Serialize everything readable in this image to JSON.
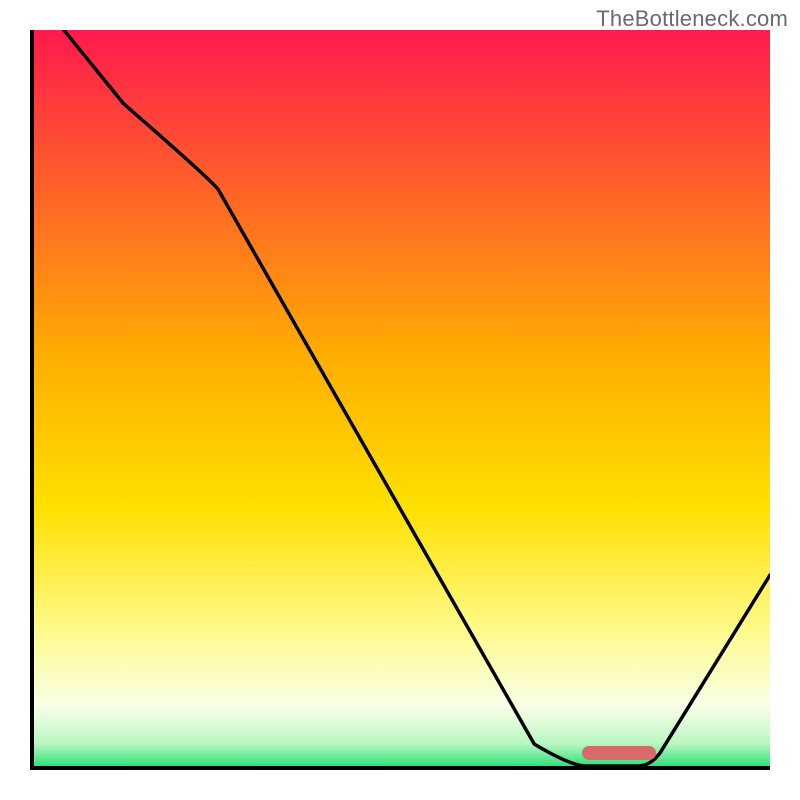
{
  "watermark": "TheBottleneck.com",
  "colors": {
    "top": "#ff1a4d",
    "mid_upper": "#ff8a2a",
    "mid": "#ffd400",
    "mid_lower": "#fff780",
    "pale": "#fdfff0",
    "green": "#2fe07a",
    "marker": "#d96a6a",
    "axis": "#000000"
  },
  "chart_data": {
    "type": "line",
    "title": "",
    "xlabel": "",
    "ylabel": "",
    "xlim": [
      0,
      100
    ],
    "ylim": [
      0,
      100
    ],
    "x": [
      4,
      12,
      25,
      68,
      75,
      82,
      100
    ],
    "y": [
      100,
      90,
      80,
      3,
      0,
      0,
      26
    ],
    "marker_range_x": [
      74,
      84
    ],
    "marker_y": 1.5,
    "gradient_stops": [
      {
        "pos": 0,
        "color": "#ff1a4d"
      },
      {
        "pos": 45,
        "color": "#ffb000"
      },
      {
        "pos": 65,
        "color": "#ffe000"
      },
      {
        "pos": 82,
        "color": "#fffb90"
      },
      {
        "pos": 92,
        "color": "#f8ffe8"
      },
      {
        "pos": 97,
        "color": "#b8f7c0"
      },
      {
        "pos": 100,
        "color": "#2fe07a"
      }
    ]
  }
}
